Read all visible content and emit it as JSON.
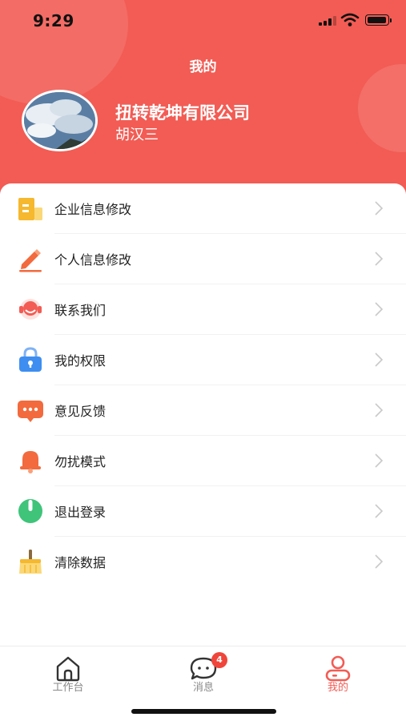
{
  "status_bar": {
    "time": "9:29"
  },
  "header": {
    "title": "我的",
    "company": "扭转乾坤有限公司",
    "user_name": "胡汉三"
  },
  "menu": [
    {
      "label": "企业信息修改",
      "icon": "building-icon",
      "color": "#f5b82e"
    },
    {
      "label": "个人信息修改",
      "icon": "pencil-icon",
      "color": "#f26a3d"
    },
    {
      "label": "联系我们",
      "icon": "headset-icon",
      "color": "#f25c54"
    },
    {
      "label": "我的权限",
      "icon": "lock-icon",
      "color": "#3d8ef0"
    },
    {
      "label": "意见反馈",
      "icon": "message-icon",
      "color": "#f26a3d"
    },
    {
      "label": "勿扰模式",
      "icon": "bell-icon",
      "color": "#f26a3d"
    },
    {
      "label": "退出登录",
      "icon": "power-icon",
      "color": "#3fc47a"
    },
    {
      "label": "清除数据",
      "icon": "broom-icon",
      "color": "#f5b82e"
    }
  ],
  "tabbar": {
    "tabs": [
      {
        "label": "工作台",
        "icon": "home-icon",
        "active": false
      },
      {
        "label": "消息",
        "icon": "chat-icon",
        "active": false,
        "badge": "4"
      },
      {
        "label": "我的",
        "icon": "user-icon",
        "active": true
      }
    ]
  },
  "colors": {
    "accent": "#f25c54",
    "tab_inactive": "#8a8a8a",
    "badge": "#f0453a"
  }
}
